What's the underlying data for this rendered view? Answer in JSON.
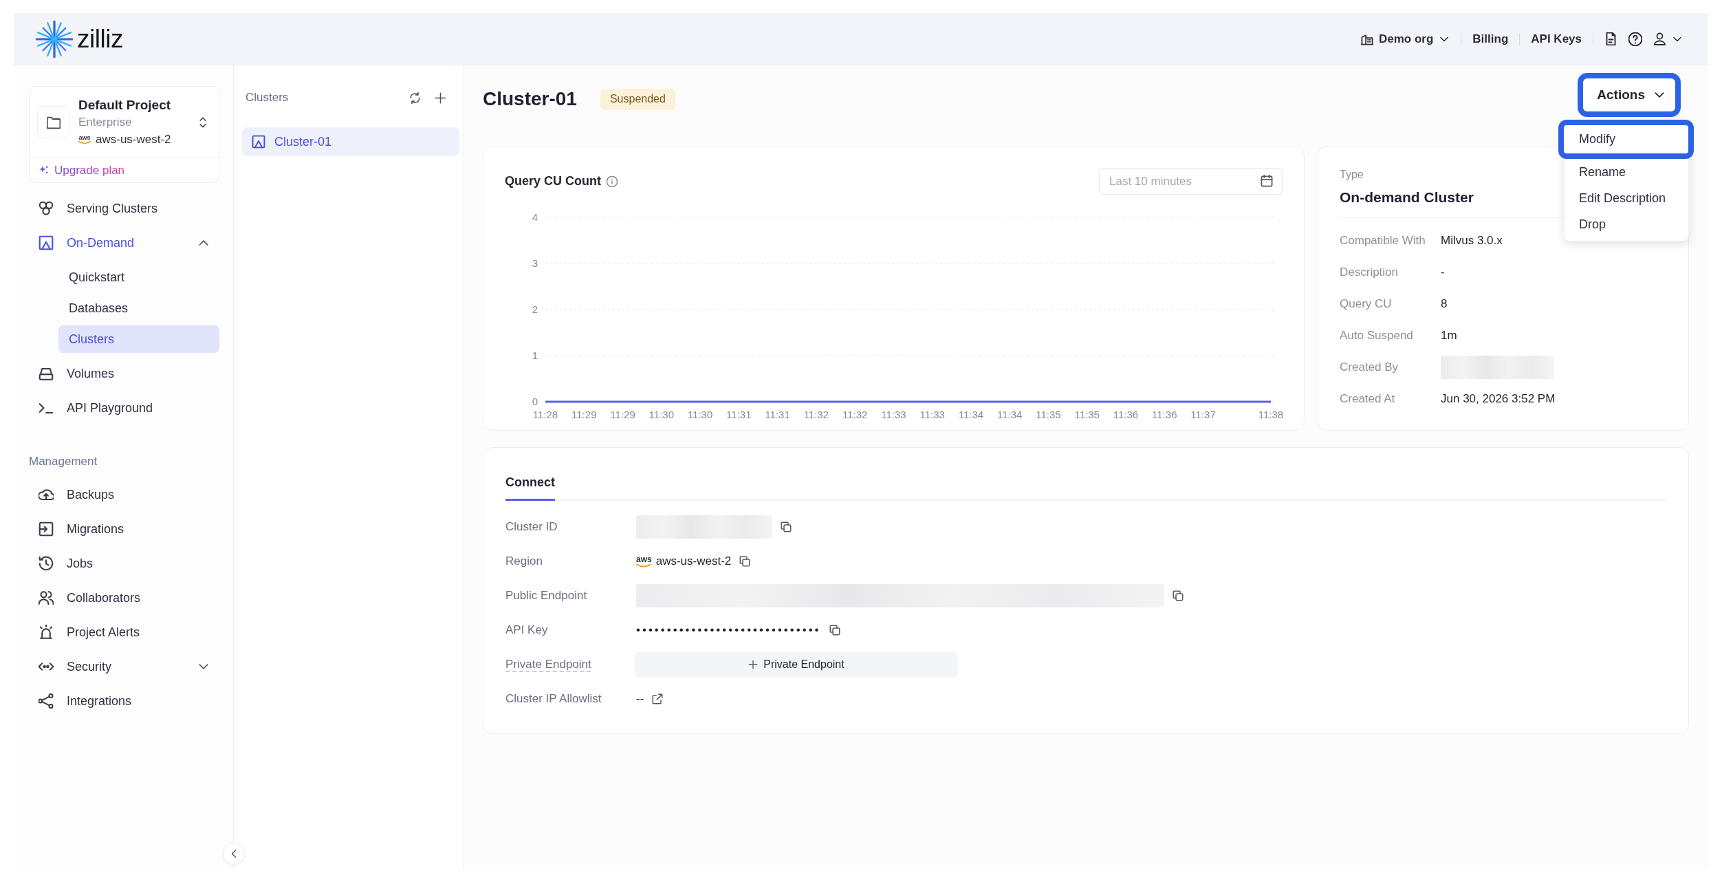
{
  "header": {
    "logo_text": "zilliz",
    "org": "Demo org",
    "links": [
      "Billing",
      "API Keys"
    ]
  },
  "sidebar": {
    "project": {
      "name": "Default Project",
      "plan": "Enterprise",
      "provider": "aws",
      "region": "aws-us-west-2",
      "upgrade": "Upgrade plan"
    },
    "sections": [
      {
        "items": [
          {
            "kind": "link",
            "label": "Serving Clusters",
            "selected": false
          },
          {
            "kind": "group",
            "label": "On-Demand",
            "selected": false,
            "expanded": true,
            "children": [
              {
                "label": "Quickstart",
                "selected": false
              },
              {
                "label": "Databases",
                "selected": false
              },
              {
                "label": "Clusters",
                "selected": true
              }
            ]
          },
          {
            "kind": "link",
            "label": "Volumes",
            "selected": false
          },
          {
            "kind": "link",
            "label": "API Playground",
            "selected": false
          }
        ]
      },
      {
        "title": "Management",
        "items": [
          {
            "kind": "link",
            "label": "Backups",
            "selected": false
          },
          {
            "kind": "link",
            "label": "Migrations",
            "selected": false
          },
          {
            "kind": "link",
            "label": "Jobs",
            "selected": false
          },
          {
            "kind": "link",
            "label": "Collaborators",
            "selected": false
          },
          {
            "kind": "link",
            "label": "Project Alerts",
            "selected": false
          },
          {
            "kind": "group",
            "label": "Security",
            "selected": false,
            "expanded": false
          },
          {
            "kind": "link",
            "label": "Integrations",
            "selected": false
          }
        ]
      }
    ]
  },
  "cluster_list": {
    "title": "Clusters",
    "items": [
      {
        "label": "Cluster-01",
        "selected": true
      }
    ]
  },
  "cluster": {
    "name": "Cluster-01",
    "status": "Suspended",
    "actions": {
      "label": "Actions",
      "highlighted": true,
      "expanded": true,
      "menu": [
        {
          "label": "Modify",
          "highlighted": true
        },
        {
          "label": "Rename",
          "highlighted": false
        },
        {
          "label": "Edit Description",
          "highlighted": false
        },
        {
          "label": "Drop",
          "highlighted": false
        }
      ]
    },
    "metrics": {
      "time_range": {
        "placeholder": "Last 10 minutes"
      },
      "chart_data": {
        "type": "line",
        "title": "Query CU Count",
        "categories": [
          "11:28",
          "11:29",
          "11:29",
          "11:30",
          "11:30",
          "11:31",
          "11:31",
          "11:32",
          "11:32",
          "11:33",
          "11:33",
          "11:34",
          "11:34",
          "11:35",
          "11:35",
          "11:36",
          "11:36",
          "11:37",
          "11:38"
        ],
        "series": [
          {
            "color": "#5b5ee8",
            "values": [
              0,
              0,
              0,
              0,
              0,
              0,
              0,
              0,
              0,
              0,
              0,
              0,
              0,
              0,
              0,
              0,
              0,
              0,
              0
            ]
          }
        ],
        "ylim": [
          0,
          4
        ],
        "yticks": [
          0,
          1,
          2,
          3,
          4
        ],
        "grid": true
      }
    },
    "details": {
      "type_label": "Type",
      "type": "On-demand Cluster",
      "rows": [
        {
          "label": "Compatible With",
          "value": "Milvus 3.0.x",
          "redacted": false
        },
        {
          "label": "Description",
          "value": "-",
          "redacted": false
        },
        {
          "label": "Query CU",
          "value": "8",
          "redacted": false
        },
        {
          "label": "Auto Suspend",
          "value": "1m",
          "redacted": false
        },
        {
          "label": "Created By",
          "redacted": true
        },
        {
          "label": "Created At",
          "value": "Jun 30, 2026 3:52 PM",
          "redacted": false
        }
      ]
    },
    "connect": {
      "tabs": [
        {
          "label": "Connect",
          "selected": true
        }
      ],
      "rows": [
        {
          "label": "Cluster ID",
          "kind": "redacted",
          "copyable": true
        },
        {
          "label": "Region",
          "kind": "region",
          "provider": "aws",
          "value": "aws-us-west-2",
          "copyable": true
        },
        {
          "label": "Public Endpoint",
          "kind": "redacted",
          "copyable": true
        },
        {
          "label": "API Key",
          "kind": "secret",
          "value": "••••••••••••••••••••••••••••••",
          "copyable": true
        },
        {
          "label": "Private Endpoint",
          "kind": "action",
          "value": "Private Endpoint",
          "copyable": false
        },
        {
          "label": "Cluster IP Allowlist",
          "kind": "link",
          "value": "--",
          "copyable": false
        }
      ]
    }
  }
}
